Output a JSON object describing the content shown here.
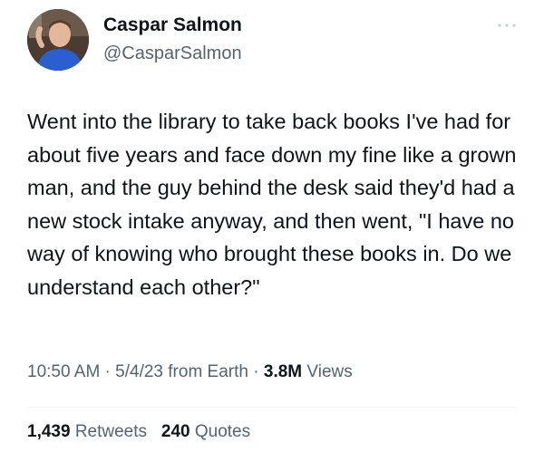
{
  "author": {
    "display_name": "Caspar Salmon",
    "handle": "@CasparSalmon",
    "avatar_icon": "profile-photo"
  },
  "header": {
    "more_icon": "more-horizontal-icon"
  },
  "tweet": {
    "text": "Went into the library to take back books I've had for about five years and face down my fine like a grown man, and the guy behind the desk said they'd had a new stock intake anyway, and then went, \"I have no way of knowing who brought these books in. Do we understand each other?\""
  },
  "meta": {
    "time": "10:50 AM",
    "separator1": " · ",
    "date": "5/4/23",
    "source": " from Earth",
    "separator2": " · ",
    "views_count": "3.8M",
    "views_label": " Views"
  },
  "stats": {
    "retweets_count": "1,439",
    "retweets_label": " Retweets",
    "quotes_count": "240",
    "quotes_label": " Quotes"
  },
  "colors": {
    "primary_text": "#0f1419",
    "secondary_text": "#536471",
    "divider": "#eff3f4",
    "avatar_shirt": "#2b5fd0"
  }
}
